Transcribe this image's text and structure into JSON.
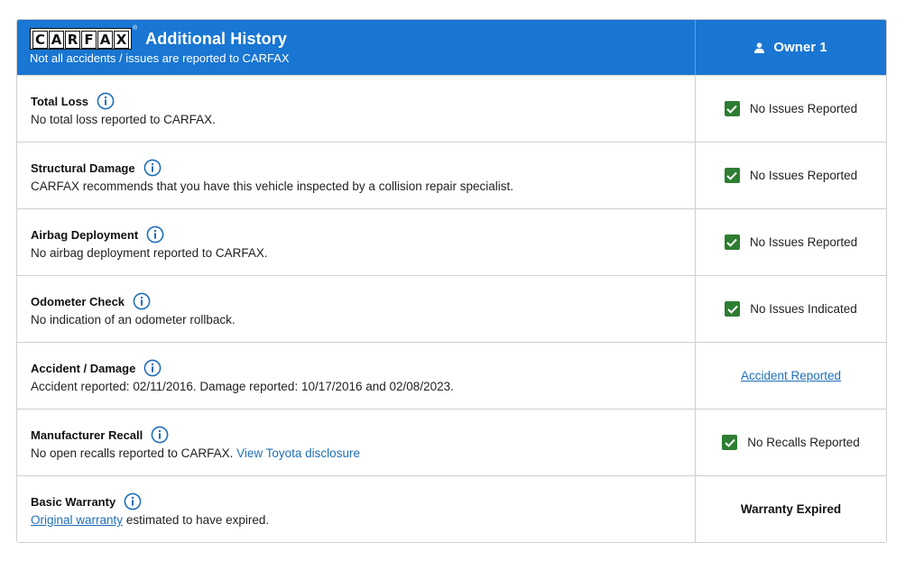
{
  "header": {
    "logo_letters": [
      "C",
      "A",
      "R",
      "F",
      "A",
      "X"
    ],
    "title": "Additional History",
    "subtitle": "Not all accidents / issues are reported to CARFAX",
    "owner_label": "Owner 1"
  },
  "rows": [
    {
      "title": "Total Loss",
      "desc": "No total loss reported to CARFAX.",
      "status": "No Issues Reported",
      "status_type": "check"
    },
    {
      "title": "Structural Damage",
      "desc": "CARFAX recommends that you have this vehicle inspected by a collision repair specialist.",
      "status": "No Issues Reported",
      "status_type": "check"
    },
    {
      "title": "Airbag Deployment",
      "desc": "No airbag deployment reported to CARFAX.",
      "status": "No Issues Reported",
      "status_type": "check"
    },
    {
      "title": "Odometer Check",
      "desc": "No indication of an odometer rollback.",
      "status": "No Issues Indicated",
      "status_type": "check"
    },
    {
      "title": "Accident / Damage",
      "desc": "Accident reported: 02/11/2016. Damage reported: 10/17/2016 and 02/08/2023.",
      "status": "Accident Reported",
      "status_type": "link"
    },
    {
      "title": "Manufacturer Recall",
      "desc": "No open recalls reported to CARFAX.",
      "desc_link": "View Toyota disclosure",
      "status": "No Recalls Reported",
      "status_type": "check"
    },
    {
      "title": "Basic Warranty",
      "desc_link_prefix": "Original warranty",
      "desc": "estimated to have expired.",
      "status": "Warranty Expired",
      "status_type": "bold"
    }
  ],
  "colors": {
    "header_bg": "#1976d2",
    "check_green": "#2e7d32",
    "link_blue": "#1f6fb8"
  },
  "icons": {
    "info": "info-circle-icon",
    "check": "checkmark-icon",
    "owner": "person-icon"
  }
}
